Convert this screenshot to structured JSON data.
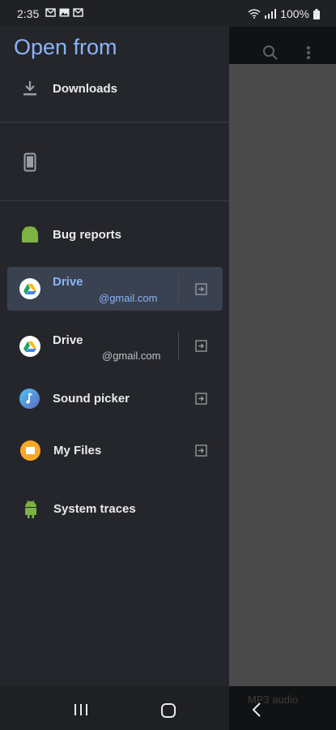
{
  "status": {
    "time": "2:35",
    "battery": "100%"
  },
  "drawer": {
    "title": "Open from",
    "items": [
      {
        "label": "Downloads"
      },
      {
        "label": ""
      },
      {
        "label": "Bug reports"
      },
      {
        "label": "Drive",
        "account": "@gmail.com",
        "selected": true
      },
      {
        "label": "Drive",
        "account": "@gmail.com"
      },
      {
        "label": "Sound picker"
      },
      {
        "label": "My Files"
      },
      {
        "label": "System traces"
      }
    ]
  },
  "background": {
    "caption": "MP3 audio"
  },
  "colors": {
    "accent": "#8ab4f8",
    "drawer_bg": "#25262b",
    "selected_bg": "#3a4150"
  }
}
